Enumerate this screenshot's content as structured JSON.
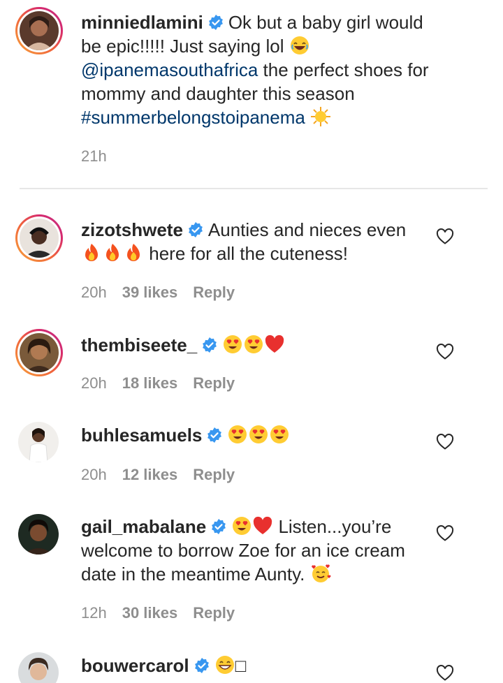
{
  "caption": {
    "username": "minniedlamini",
    "text_1": "Ok but a baby girl would be epic!!!!! Just saying lol",
    "mention": "@ipanemasouthafrica",
    "text_2": "the perfect shoes for mommy and daughter this season",
    "hashtag": "#summerbelongstoipanema",
    "time": "21h"
  },
  "comments": [
    {
      "username": "zizotshwete",
      "text_1": "Aunties and nieces even",
      "text_2": "here for all the cuteness!",
      "time": "20h",
      "likes": "39 likes",
      "reply": "Reply"
    },
    {
      "username": "thembiseete_",
      "time": "20h",
      "likes": "18 likes",
      "reply": "Reply"
    },
    {
      "username": "buhlesamuels",
      "time": "20h",
      "likes": "12 likes",
      "reply": "Reply"
    },
    {
      "username": "gail_mabalane",
      "text_1": "Listen...you’re welcome to borrow Zoe for an ice cream date in the meantime Aunty.",
      "time": "12h",
      "likes": "30 likes",
      "reply": "Reply"
    },
    {
      "username": "bouwercarol",
      "text_2": "□"
    }
  ],
  "colors": {
    "text": "#262626",
    "meta": "#8e8e8e",
    "link": "#00376b",
    "verified": "#3897f0"
  }
}
